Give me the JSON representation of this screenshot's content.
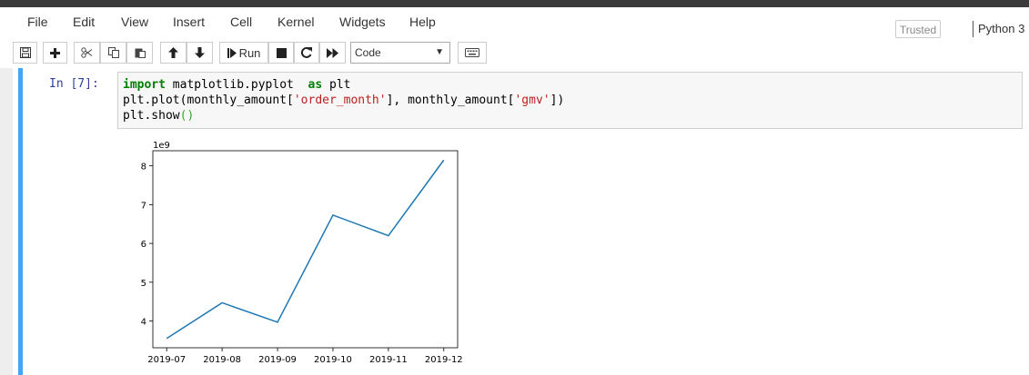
{
  "menu": {
    "items": [
      "File",
      "Edit",
      "View",
      "Insert",
      "Cell",
      "Kernel",
      "Widgets",
      "Help"
    ],
    "trusted_label": "Trusted",
    "kernel_name": "Python 3"
  },
  "toolbar": {
    "icons": [
      "save-icon",
      "plus-icon",
      "cut-icon",
      "copy-icon",
      "paste-icon",
      "arrow-up-icon",
      "arrow-down-icon",
      "run-icon",
      "stop-icon",
      "restart-icon",
      "fast-forward-icon",
      "keyboard-icon"
    ],
    "run_label": "Run",
    "cell_type_value": "Code"
  },
  "cell": {
    "prompt": "In [7]:",
    "code": {
      "line1": {
        "kw1": "import",
        "mid": " matplotlib.pyplot  ",
        "kw2": "as",
        "end": " plt"
      },
      "line2": {
        "a": "plt.plot(monthly_amount[",
        "s1": "'order_month'",
        "b": "], monthly_amount[",
        "s2": "'gmv'",
        "c": "])"
      },
      "line3": {
        "a": "plt.show",
        "p": "()"
      }
    }
  },
  "chart_data": {
    "type": "line",
    "x": [
      "2019-07",
      "2019-08",
      "2019-09",
      "2019-10",
      "2019-11",
      "2019-12"
    ],
    "series": [
      {
        "values": [
          3.55,
          4.47,
          3.97,
          6.73,
          6.2,
          8.15
        ],
        "color": "#1f77b4"
      }
    ],
    "ylim": [
      3.31,
      8.39
    ],
    "yticks": [
      4,
      5,
      6,
      7,
      8
    ],
    "y_offset_label": "1e9",
    "xlabel": "",
    "ylabel": "",
    "grid": false
  }
}
